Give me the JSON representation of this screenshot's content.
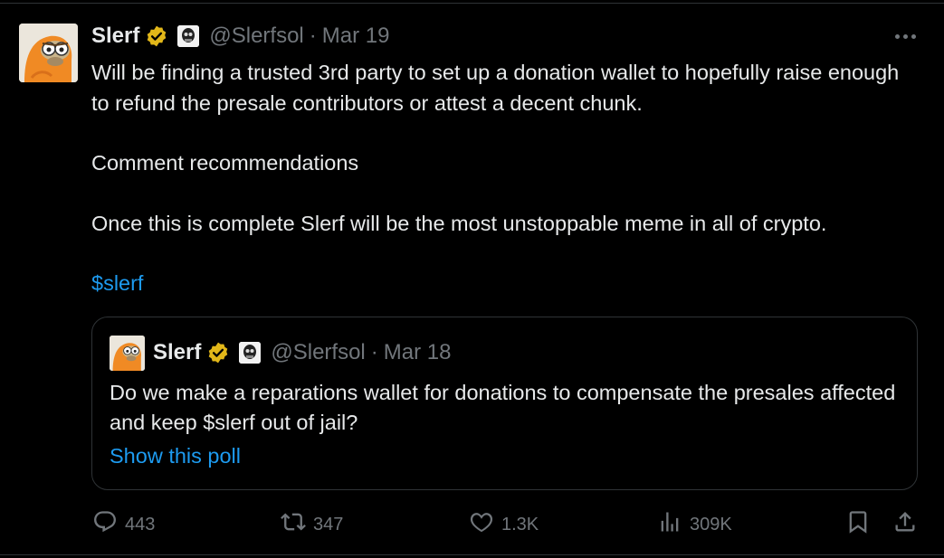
{
  "tweet": {
    "author_name": "Slerf",
    "handle": "@Slerfsol",
    "separator": "·",
    "date": "Mar 19",
    "text_lines": [
      "Will be finding a trusted 3rd party  to set up a donation wallet to hopefully raise enough to refund the presale contributors or attest a decent chunk.",
      "Comment recommendations",
      "Once this is complete Slerf will be the most unstoppable meme in all of crypto."
    ],
    "hashtag": "$slerf"
  },
  "quote": {
    "author_name": "Slerf",
    "handle": "@Slerfsol",
    "separator": "·",
    "date": "Mar 18",
    "text": "Do we make a reparations wallet for donations to compensate the presales affected and keep $slerf out of jail?",
    "poll_link": "Show this poll"
  },
  "actions": {
    "replies": "443",
    "reposts": "347",
    "likes": "1.3K",
    "views": "309K"
  },
  "colors": {
    "background": "#000000",
    "text": "#e7e9ea",
    "secondary": "#71767b",
    "link": "#1d9bf0",
    "verified": "#e2b719",
    "border": "#2f3336"
  },
  "icons": [
    "verified-badge-icon",
    "affiliate-badge-icon",
    "more-icon",
    "reply-icon",
    "repost-icon",
    "like-icon",
    "views-icon",
    "bookmark-icon",
    "share-icon"
  ]
}
